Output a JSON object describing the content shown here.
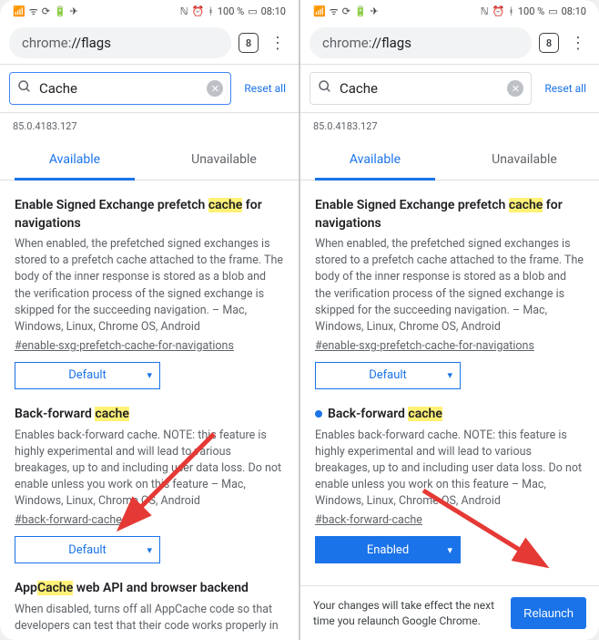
{
  "status": {
    "left_icons": [
      "signal",
      "wifi",
      "sync",
      "battery",
      "telegram"
    ],
    "right": "100 %",
    "time": "08:10",
    "right_icons": [
      "nfc",
      "alarm",
      "bluetooth"
    ]
  },
  "url": {
    "prefix": "chrome:",
    "suffix": "//flags"
  },
  "tabcount": "8",
  "search": {
    "query": "Cache",
    "reset": "Reset all"
  },
  "version": "85.0.4183.127",
  "tabs": {
    "available": "Available",
    "unavailable": "Unavailable"
  },
  "flag1": {
    "title_pre": "Enable Signed Exchange prefetch ",
    "title_hl": "cache",
    "title_post": " for navigations",
    "desc": "When enabled, the prefetched signed exchanges is stored to a prefetch cache attached to the frame. The body of the inner response is stored as a blob and the verification process of the signed exchange is skipped for the succeeding navigation. – Mac, Windows, Linux, Chrome OS, Android",
    "tag": "#enable-sxg-prefetch-cache-for-navigations",
    "select": "Default"
  },
  "flag2": {
    "title_pre": "Back-forward ",
    "title_hl": "cache",
    "desc_left": "Enables back-forward cache. NOTE: this feature is highly experimental and will lead to various breakages, up to and including user data loss. Do not enable unless you work on this feature – Mac, Windows, Linux, Chrome OS, Android",
    "desc_right": "Enables back-forward cache. NOTE: this feature is highly experimental and will lead to various breakages, up to and including user data loss. Do not enable unless you work on this feature – Mac, Windows, Linux, Chrome OS, Android",
    "tag": "#back-forward-cache",
    "select_left": "Default",
    "select_right": "Enabled"
  },
  "flag3": {
    "title_pre": "App",
    "title_hl": "Cache",
    "title_post": " web API and browser backend",
    "desc": "When disabled, turns off all AppCache code so that developers can test that their code works properly in"
  },
  "relaunch": {
    "msg": "Your changes will take effect the next time you relaunch Google Chrome.",
    "btn": "Relaunch"
  }
}
